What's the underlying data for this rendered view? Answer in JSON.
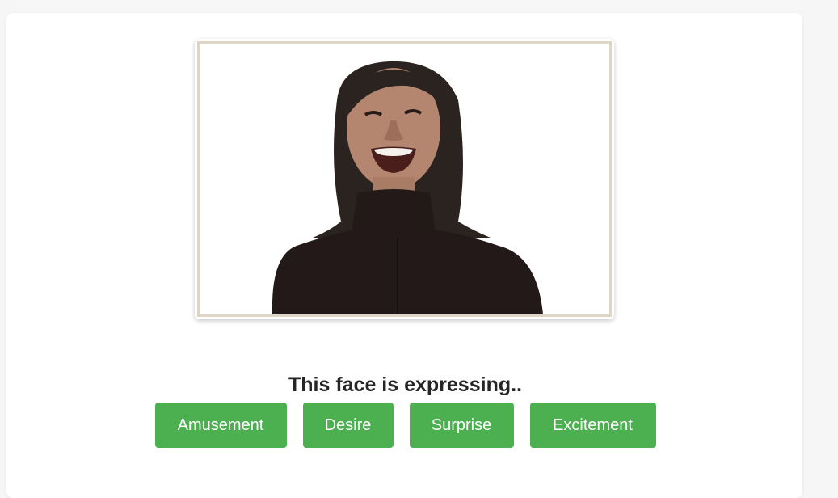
{
  "prompt_text": "This face is expressing..",
  "choices": [
    {
      "label": "Amusement"
    },
    {
      "label": "Desire"
    },
    {
      "label": "Surprise"
    },
    {
      "label": "Excitement"
    }
  ],
  "colors": {
    "button": "#4caf50",
    "frame_border": "#ddd5c6"
  }
}
